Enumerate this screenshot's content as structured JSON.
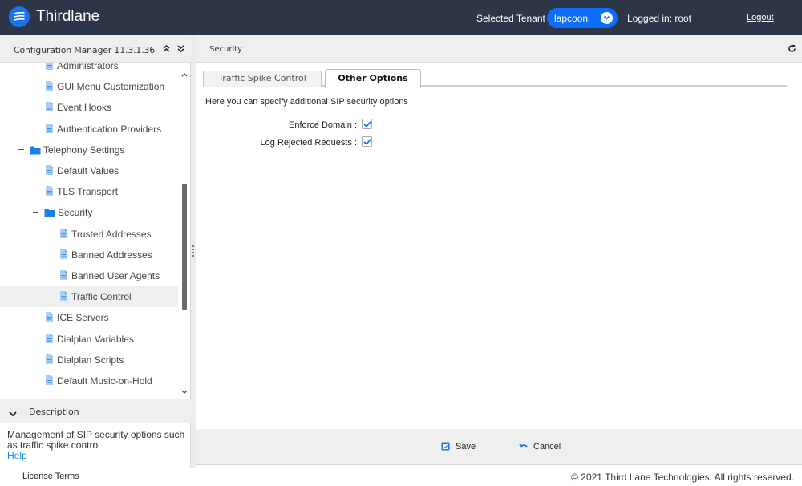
{
  "header": {
    "brand": "Thirdlane",
    "tenant_label": "Selected Tenant :",
    "tenant_value": "lapcoon",
    "logged_in": "Logged in: root",
    "logout": "Logout",
    "colors": {
      "header_bg": "#2d3649",
      "accent": "#0d6efd"
    }
  },
  "left_panel": {
    "title": "Configuration Manager 11.3.1.36",
    "collapse_all_icon": "double-chevron-up-icon",
    "expand_all_icon": "double-chevron-down-icon",
    "tree": [
      {
        "label": "Administrators",
        "type": "file",
        "level": 2
      },
      {
        "label": "GUI Menu Customization",
        "type": "file",
        "level": 2
      },
      {
        "label": "Event Hooks",
        "type": "file",
        "level": 2
      },
      {
        "label": "Authentication Providers",
        "type": "file",
        "level": 2
      },
      {
        "label": "Telephony Settings",
        "type": "folder",
        "level": 1,
        "expanded": true
      },
      {
        "label": "Default Values",
        "type": "file",
        "level": 2
      },
      {
        "label": "TLS Transport",
        "type": "file",
        "level": 2
      },
      {
        "label": "Security",
        "type": "folder",
        "level": 2,
        "expanded": true
      },
      {
        "label": "Trusted Addresses",
        "type": "file",
        "level": 3
      },
      {
        "label": "Banned Addresses",
        "type": "file",
        "level": 3
      },
      {
        "label": "Banned User Agents",
        "type": "file",
        "level": 3
      },
      {
        "label": "Traffic Control",
        "type": "file",
        "level": 3,
        "selected": true
      },
      {
        "label": "ICE Servers",
        "type": "file",
        "level": 2
      },
      {
        "label": "Dialplan Variables",
        "type": "file",
        "level": 2
      },
      {
        "label": "Dialplan Scripts",
        "type": "file",
        "level": 2
      },
      {
        "label": "Default Music-on-Hold",
        "type": "file",
        "level": 2
      }
    ],
    "description": {
      "title": "Description",
      "text": "Management of SIP security options such as traffic spike control",
      "help_link": "Help"
    }
  },
  "main": {
    "title": "Security",
    "tabs": [
      {
        "label": "Traffic Spike Control",
        "active": false
      },
      {
        "label": "Other Options",
        "active": true
      }
    ],
    "intro": "Here you can specify additional SIP security options",
    "fields": [
      {
        "label": "Enforce Domain :",
        "checked": true
      },
      {
        "label": "Log Rejected Requests :",
        "checked": true
      }
    ],
    "buttons": {
      "save": "Save",
      "cancel": "Cancel"
    }
  },
  "footer": {
    "license": "License Terms",
    "copyright": "© 2021 Third Lane Technologies. All rights reserved."
  }
}
